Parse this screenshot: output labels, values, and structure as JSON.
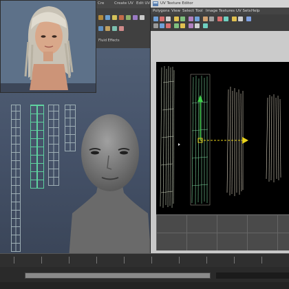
{
  "app": {
    "menu_fragments": [
      "Cre",
      "Create UV",
      "Edit UV"
    ],
    "shelf_tab": "Fluid Effects"
  },
  "uv_editor": {
    "title": "UV Texture Editor",
    "menu": [
      "Polygons",
      "View",
      "Select",
      "Tool",
      "Image",
      "Textures",
      "UV Sets",
      "Help"
    ]
  },
  "colors": {
    "uv_selection": "#5fd3a0",
    "uv_wire": "#9fb0b6",
    "manipulator_y": "#3fd24a",
    "manipulator_x": "#e8d21c"
  },
  "icons": [
    "hair-preview-render",
    "head-model",
    "uv-shells",
    "move-manipulator"
  ]
}
